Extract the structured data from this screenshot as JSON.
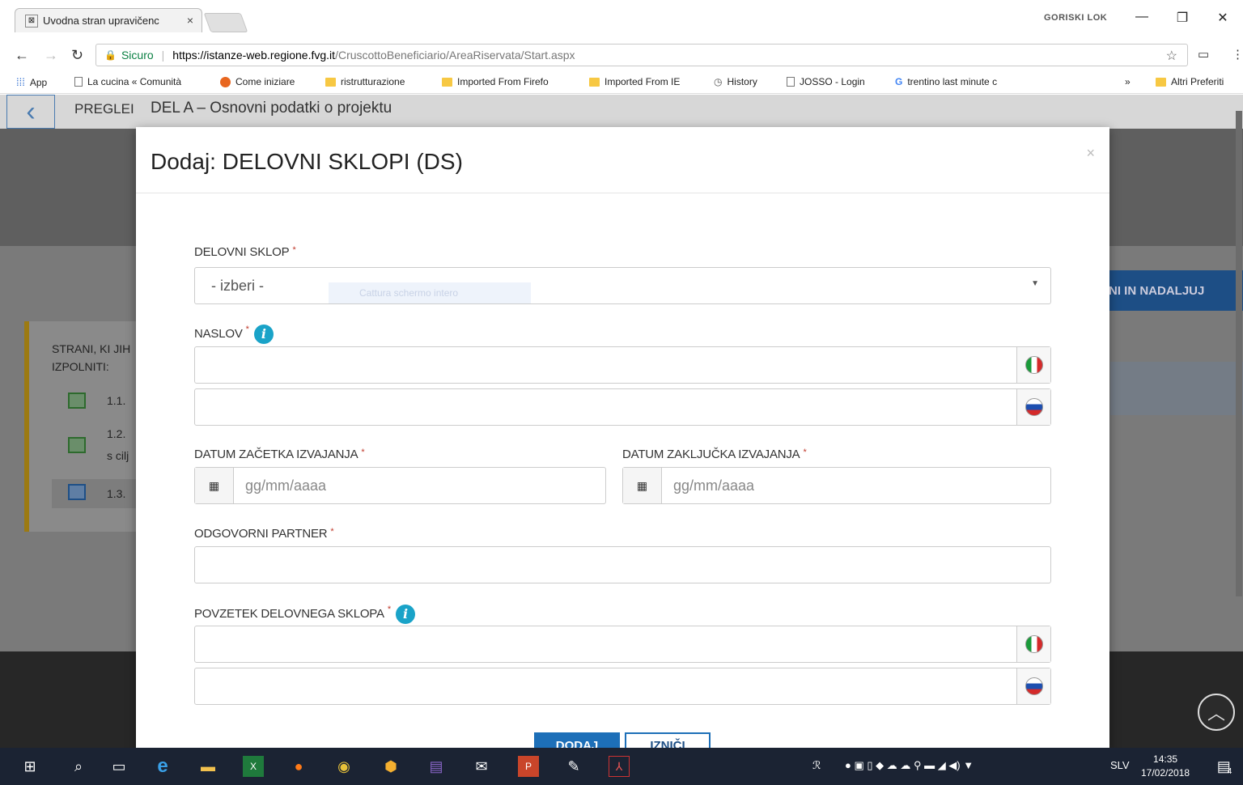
{
  "browser": {
    "tab_title": "Uvodna stran upravičenc",
    "tab_close": "×",
    "profile_name": "GORISKI LOK",
    "window_controls": {
      "minimize": "—",
      "restore": "❐",
      "close": "✕"
    },
    "secure_label": "Sicuro",
    "url_host": "https://istanze-web.regione.fvg.it",
    "url_path": "/CruscottoBeneficiario/AreaRiservata/Start.aspx",
    "bookmarks": [
      {
        "label": "App",
        "icon": "apps-icon"
      },
      {
        "label": "La cucina « Comunità",
        "icon": "page-icon"
      },
      {
        "label": "Come iniziare",
        "icon": "firefox-icon"
      },
      {
        "label": "ristrutturazione",
        "icon": "folder-icon"
      },
      {
        "label": "Imported From Firefo",
        "icon": "folder-icon"
      },
      {
        "label": "Imported From IE",
        "icon": "folder-icon"
      },
      {
        "label": "History",
        "icon": "history-icon"
      },
      {
        "label": "JOSSO - Login",
        "icon": "page-icon"
      },
      {
        "label": "trentino last minute c",
        "icon": "google-icon"
      }
    ],
    "bookmarks_overflow": "»",
    "other_bookmarks": "Altri Preferiti"
  },
  "page": {
    "breadcrumb_root": "PREGLEI",
    "breadcrumb_title": "DEL A – Osnovni podatki o projektu",
    "save_continue_label": "NI IN NADALJUJ",
    "sidebar_title": "STRANI, KI JIH IZPOLNITI:",
    "sidebar_items": [
      {
        "label": "1.1."
      },
      {
        "label": "1.2."
      },
      {
        "label": "s cilj"
      },
      {
        "label": "1.3."
      }
    ]
  },
  "modal": {
    "title": "Dodaj: DELOVNI SKLOPI (DS)",
    "close": "×",
    "fields": {
      "work_package": {
        "label": "DELOVNI SKLOP",
        "value": "- izberi -"
      },
      "title": {
        "label": "NASLOV"
      },
      "start_date": {
        "label": "DATUM ZAČETKA IZVAJANJA",
        "placeholder": "gg/mm/aaaa"
      },
      "end_date": {
        "label": "DATUM ZAKLJUČKA IZVAJANJA",
        "placeholder": "gg/mm/aaaa"
      },
      "partner": {
        "label": "ODGOVORNI PARTNER"
      },
      "summary": {
        "label": "POVZETEK DELOVNEGA SKLOPA"
      }
    },
    "required_mark": "*",
    "ghost_tooltip": "Cattura schermo intero",
    "buttons": {
      "primary": "DODAJ",
      "secondary": "IZNIČI"
    }
  },
  "taskbar": {
    "language": "SLV",
    "time": "14:35",
    "date": "17/02/2018",
    "notification_count": "4"
  }
}
